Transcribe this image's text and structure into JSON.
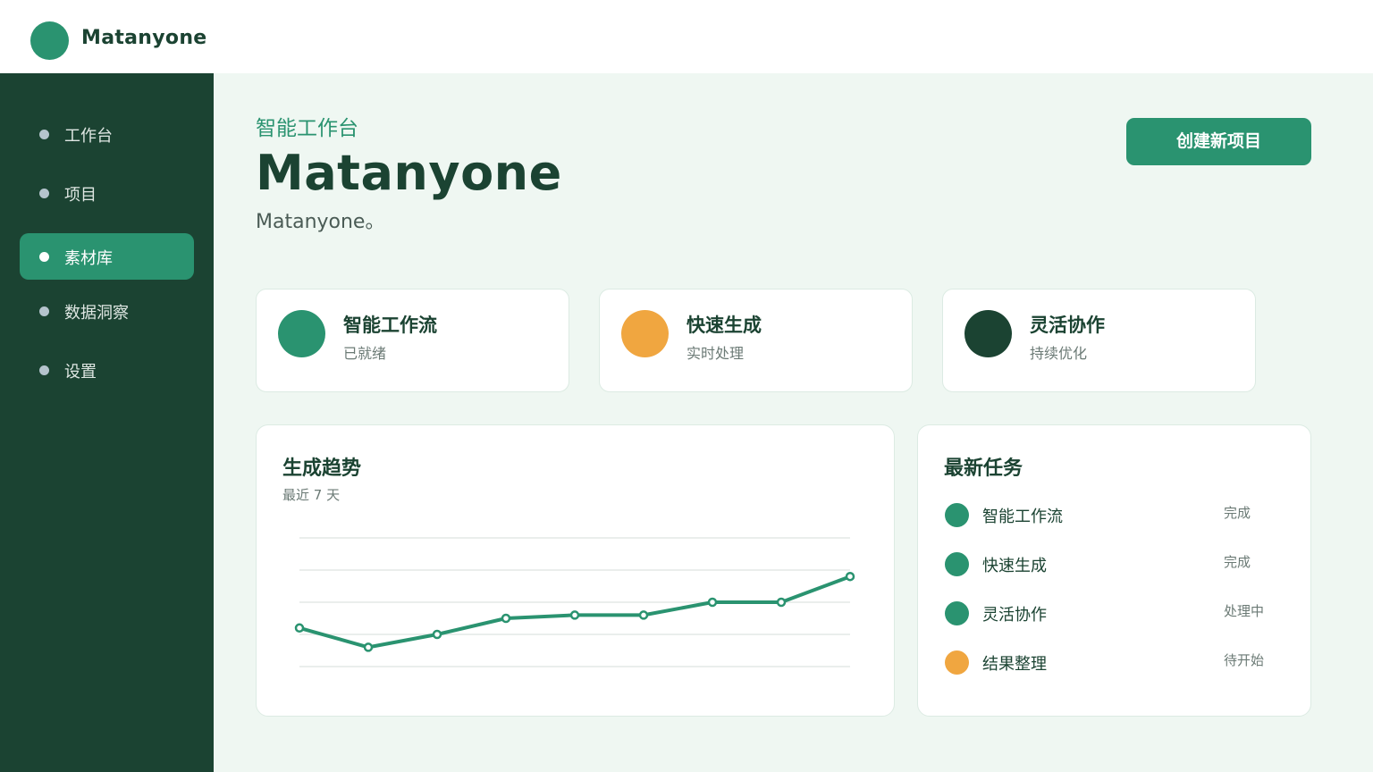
{
  "app": {
    "brand": "Matanyone"
  },
  "sidebar": {
    "items": [
      {
        "label": "工作台",
        "active": false
      },
      {
        "label": "项目",
        "active": false
      },
      {
        "label": "素材库",
        "active": true
      },
      {
        "label": "数据洞察",
        "active": false
      },
      {
        "label": "设置",
        "active": false
      }
    ]
  },
  "header": {
    "eyebrow": "智能工作台",
    "title": "Matanyone",
    "subtitle": "Matanyone。",
    "cta_label": "创建新项目"
  },
  "features": [
    {
      "title": "智能工作流",
      "subtitle": "已就绪",
      "color": "#2a9370"
    },
    {
      "title": "快速生成",
      "subtitle": "实时处理",
      "color": "#f0a640"
    },
    {
      "title": "灵活协作",
      "subtitle": "持续优化",
      "color": "#1b4332"
    }
  ],
  "trend": {
    "title": "生成趋势",
    "subtitle": "最近 7 天"
  },
  "chart_data": {
    "type": "line",
    "x": [
      1,
      2,
      3,
      4,
      5,
      6,
      7,
      8,
      9
    ],
    "series": [
      {
        "values": [
          52,
          46,
          50,
          55,
          56,
          56,
          60,
          60,
          68
        ],
        "color": "#2a9370"
      }
    ],
    "ylim": [
      40,
      80
    ],
    "grid": true,
    "xlabel": "",
    "ylabel": ""
  },
  "tasks": {
    "title": "最新任务",
    "items": [
      {
        "name": "智能工作流",
        "status": "完成",
        "color": "#2a9370"
      },
      {
        "name": "快速生成",
        "status": "完成",
        "color": "#2a9370"
      },
      {
        "name": "灵活协作",
        "status": "处理中",
        "color": "#2a9370"
      },
      {
        "name": "结果整理",
        "status": "待开始",
        "color": "#f0a640"
      }
    ]
  },
  "colors": {
    "primary": "#2a9370",
    "dark": "#1b4332",
    "accent": "#f0a640",
    "background": "#eff7f2"
  }
}
